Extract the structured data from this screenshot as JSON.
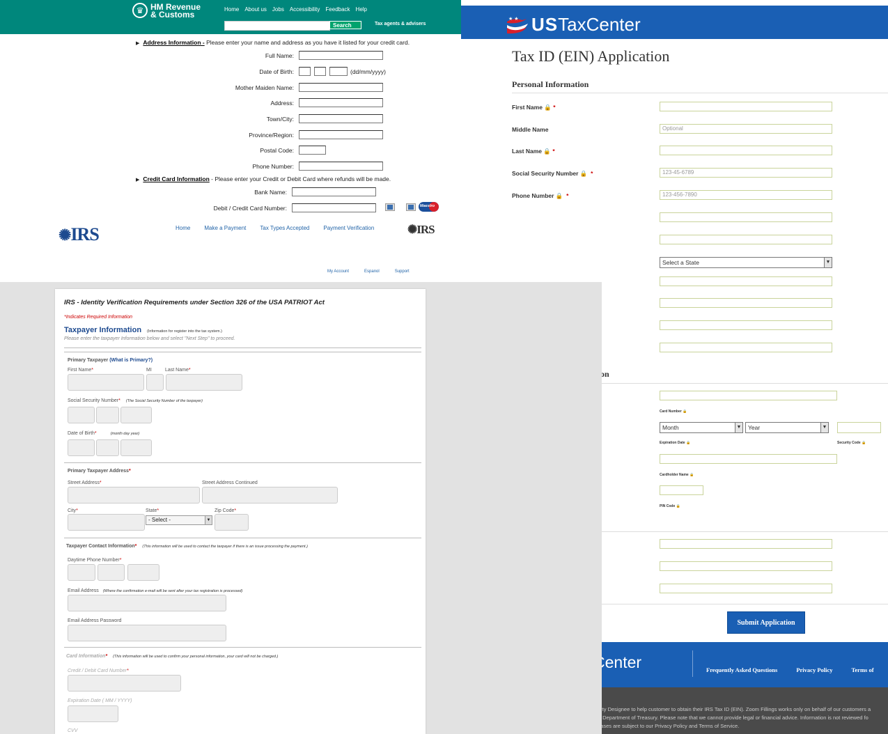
{
  "hmrc": {
    "brand_line1": "HM Revenue",
    "brand_line2": "& Customs",
    "nav": [
      "Home",
      "About us",
      "Jobs",
      "Accessibility",
      "Feedback",
      "Help"
    ],
    "search_button": "Search",
    "agents_link": "Tax agents & advisers",
    "address_heading": "Address Information -",
    "address_text": "Please enter your name and address as you have it listed for your credit card.",
    "address_fields": [
      "Full Name:",
      "Date of Birth:",
      "Mother Maiden Name:",
      "Address:",
      "Town/City:",
      "Province/Region:",
      "Postal Code:",
      "Phone Number:"
    ],
    "dob_hint": "(dd/mm/yyyy)",
    "card_heading": "Credit Card Information",
    "card_text": "- Please enter your Credit or Debit Card where refunds will be made.",
    "card_fields": [
      "Bank Name:",
      "Debit / Credit Card Number:"
    ],
    "maestro": "Maestro",
    "irs_logo": "IRS",
    "irs_nav": [
      "Home",
      "Make a Payment",
      "Tax Types Accepted",
      "Payment Verification"
    ],
    "irs_nav2": [
      "My Account",
      "Espanol",
      "Support"
    ]
  },
  "utc": {
    "logo_us": "US",
    "logo_rest": "TaxCenter",
    "page_title": "Tax ID (EIN) Application",
    "section_personal": "Personal Information",
    "fields": [
      {
        "label": "First Name",
        "placeholder": ""
      },
      {
        "label": "Middle Name",
        "placeholder": "Optional"
      },
      {
        "label": "Last Name",
        "placeholder": ""
      },
      {
        "label": "Social Security Number",
        "placeholder": "123-45-6789"
      },
      {
        "label": "Phone Number",
        "placeholder": "123-456-7890"
      }
    ],
    "state_select": "Select a State",
    "section_partial": "on",
    "card_number_label": "Card Number",
    "month_select": "Month",
    "year_select": "Year",
    "expiration_label": "Expiration Date",
    "security_label": "Security Code",
    "cardholder_label": "Cardholder Name",
    "pin_label": "PIN Code",
    "submit": "Submit Application",
    "footer_logo": "Center",
    "footer_links": [
      "Frequently Asked Questions",
      "Privacy Policy",
      "Terms of"
    ],
    "footer_text": [
      "arty Designee to help customer to obtain their IRS Tax ID (EIN). Zoom Fillings works only on behalf of our customers a",
      "S Department of Treasury. Please note that we cannot provide legal or financial advice. Information is not reviewed fo",
      "hases are subject to our Privacy Policy and Terms of Service."
    ]
  },
  "irsform": {
    "title": "IRS - Identity Verification Requirements under Section 326 of the USA PATRIOT Act",
    "required_note": "*Indicates Required Information",
    "taxpayer_info": "Taxpayer Information",
    "taxpayer_info_note": "(Information for register into the tax system.)",
    "please": "Please enter the taxpayer Information below and select \"Next Step\" to proceed.",
    "primary_taxpayer": "Primary Taxpayer",
    "what_is_primary": "(What is Primary?)",
    "first_name": "First Name",
    "mi": "MI",
    "last_name": "Last Name",
    "ssn": "Social Security Number",
    "ssn_note": "(The Social Security Number of the taxpayer)",
    "dob": "Date of Birth",
    "dob_note": "(month     day     year)",
    "address_heading": "Primary Taxpayer Address",
    "street": "Street Address",
    "street2": "Street Address Continued",
    "city": "City",
    "state": "State",
    "state_select": "- Select -",
    "zip": "Zip Code",
    "contact_heading": "Taxpayer Contact Information",
    "contact_note": "(This information will be used to contact the taxpayer if there is an issue processing the payment.)",
    "phone": "Daytime Phone Number",
    "email": "Email Address",
    "email_note": "(Where the confirmation e-mail will be sent after your tax registration is processed)",
    "email_pw": "Email Address Password",
    "card_heading": "Card Information",
    "card_note": "(This information will be used to confirm your personal information, your card will not be charged.)",
    "card_number": "Credit / Debit Card Number",
    "expiration": "Expiration Date ( MM / YYYY)",
    "cvv": "CVV"
  },
  "colors": {
    "hmrc_green": "#00877c",
    "utc_blue": "#1a5fb4",
    "irs_blue": "#1d4a8f",
    "required_red": "#cc0000",
    "background_gray": "#e2e2e2"
  }
}
